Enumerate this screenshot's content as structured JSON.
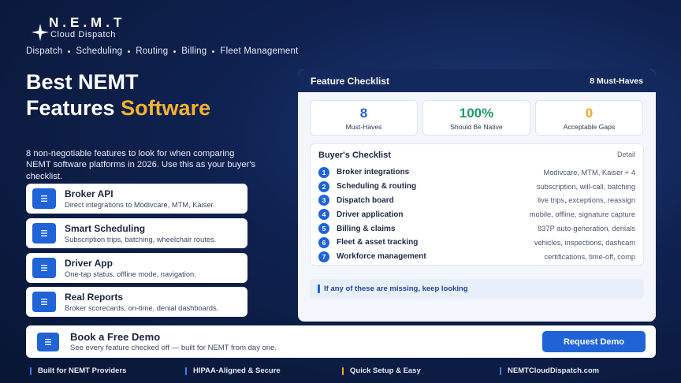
{
  "brand": {
    "title": "N.E.M.T",
    "subtitle": "Cloud Dispatch"
  },
  "nav": [
    "Dispatch",
    "Scheduling",
    "Routing",
    "Billing",
    "Fleet Management"
  ],
  "hero": {
    "line1": "Best NEMT",
    "line2_prefix": "Features ",
    "line2_accent": "Software"
  },
  "intro": "8 non-negotiable features to look for when comparing NEMT software platforms in 2026. Use this as your buyer's checklist.",
  "features": [
    {
      "title": "Broker API",
      "desc": "Direct integrations to Modivcare, MTM, Kaiser."
    },
    {
      "title": "Smart Scheduling",
      "desc": "Subscription trips, batching, wheelchair routes."
    },
    {
      "title": "Driver App",
      "desc": "One-tap status, offline mode, navigation."
    },
    {
      "title": "Real Reports",
      "desc": "Broker scorecards, on-time, denial dashboards."
    }
  ],
  "panel": {
    "title": "Feature Checklist",
    "count": "8 Must-Haves",
    "stats": [
      {
        "value": "8",
        "label": "Must-Haves",
        "color": "#1f63d6"
      },
      {
        "value": "100%",
        "label": "Should Be Native",
        "color": "#1f9a6b"
      },
      {
        "value": "0",
        "label": "Acceptable Gaps",
        "color": "#f0a722"
      }
    ],
    "checklist_title": "Buyer's Checklist",
    "checklist_detail": "Detail",
    "rows": [
      {
        "num": "1",
        "name": "Broker integrations",
        "value": "Modivcare, MTM, Kaiser + 4"
      },
      {
        "num": "2",
        "name": "Scheduling & routing",
        "value": "subscription, will-call, batching"
      },
      {
        "num": "3",
        "name": "Dispatch board",
        "value": "live trips, exceptions, reassign"
      },
      {
        "num": "4",
        "name": "Driver application",
        "value": "mobile, offline, signature capture"
      },
      {
        "num": "5",
        "name": "Billing & claims",
        "value": "837P auto-generation, denials"
      },
      {
        "num": "6",
        "name": "Fleet & asset tracking",
        "value": "vehicles, inspections, dashcam"
      },
      {
        "num": "7",
        "name": "Workforce management",
        "value": "certifications, time-off, comp"
      }
    ],
    "note": "If any of these are missing, keep looking"
  },
  "cta": {
    "title": "Book a Free Demo",
    "subtitle": "See every feature checked off — built for NEMT from day one.",
    "button": "Request Demo"
  },
  "footer": [
    {
      "label": "Built for NEMT Providers",
      "color": "#3f7be8"
    },
    {
      "label": "HIPAA-Aligned & Secure",
      "color": "#3f7be8"
    },
    {
      "label": "Quick Setup & Easy",
      "color": "#f0a722"
    },
    {
      "label": "NEMTCloudDispatch.com",
      "color": "#3f7be8"
    }
  ],
  "colors": {
    "accent": "#f6b331",
    "brand_blue": "#1f63d6",
    "navy": "#13295d"
  }
}
